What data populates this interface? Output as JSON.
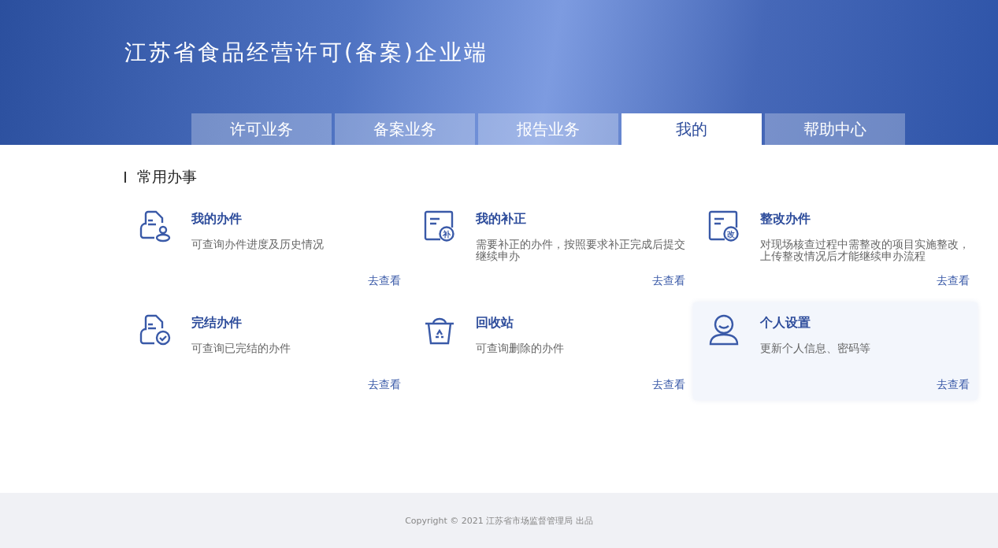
{
  "header": {
    "title": "江苏省食品经营许可(备案)企业端"
  },
  "tabs": [
    {
      "label": "许可业务",
      "selected": false
    },
    {
      "label": "备案业务",
      "selected": false
    },
    {
      "label": "报告业务",
      "selected": false
    },
    {
      "label": "我的",
      "selected": true
    },
    {
      "label": "帮助中心",
      "selected": false
    }
  ],
  "section": {
    "title": "常用办事"
  },
  "cards": [
    {
      "kind": "person-doc",
      "title": "我的办件",
      "description": "可查询办件进度及历史情况",
      "link": "去查看",
      "highlighted": false
    },
    {
      "kind": "badge-doc",
      "badge": "补",
      "title": "我的补正",
      "description": "需要补正的办件，按照要求补正完成后提交继续申办",
      "link": "去查看",
      "highlighted": false
    },
    {
      "kind": "badge-doc",
      "badge": "改",
      "title": "整改办件",
      "description": "对现场核查过程中需整改的项目实施整改，上传整改情况后才能继续申办流程",
      "link": "去查看",
      "highlighted": false
    },
    {
      "kind": "check-doc",
      "title": "完结办件",
      "description": "可查询已完结的办件",
      "link": "去查看",
      "highlighted": false
    },
    {
      "kind": "recycle",
      "title": "回收站",
      "description": "可查询删除的办件",
      "link": "去查看",
      "highlighted": false
    },
    {
      "kind": "user",
      "title": "个人设置",
      "description": "更新个人信息、密码等",
      "link": "去查看",
      "highlighted": true
    }
  ],
  "footer": {
    "copyright": "Copyright © 2021 江苏省市场监督管理局 出品"
  }
}
